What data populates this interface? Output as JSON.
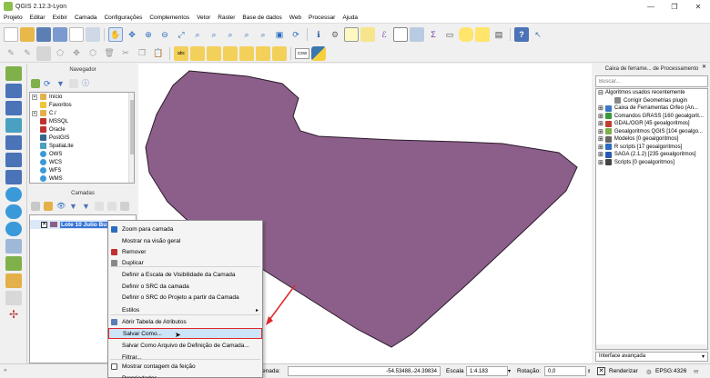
{
  "window": {
    "title": "QGIS 2.12.3-Lyon"
  },
  "menu": [
    "Projeto",
    "Editar",
    "Exibir",
    "Camada",
    "Configurações",
    "Complementos",
    "Vetor",
    "Raster",
    "Base de dados",
    "Web",
    "Processar",
    "Ajuda"
  ],
  "toolbar": {
    "csw_label": "CSW"
  },
  "navigator": {
    "title": "Navegador",
    "items": [
      {
        "label": "Início",
        "icon": "folder-icon",
        "expandable": true
      },
      {
        "label": "Favoritos",
        "icon": "star-icon",
        "expandable": false
      },
      {
        "label": "C:/",
        "icon": "folder-icon",
        "expandable": true
      },
      {
        "label": "MSSQL",
        "icon": "database-icon",
        "expandable": false
      },
      {
        "label": "Oracle",
        "icon": "database-icon",
        "expandable": false
      },
      {
        "label": "PostGIS",
        "icon": "postgis-icon",
        "expandable": false
      },
      {
        "label": "SpatiaLite",
        "icon": "spatialite-icon",
        "expandable": false
      },
      {
        "label": "OWS",
        "icon": "globe-icon",
        "expandable": false
      },
      {
        "label": "WCS",
        "icon": "globe-icon",
        "expandable": false
      },
      {
        "label": "WFS",
        "icon": "globe-icon",
        "expandable": false
      },
      {
        "label": "WMS",
        "icon": "globe-icon",
        "expandable": false
      }
    ]
  },
  "layers_panel": {
    "title": "Camadas",
    "layer": {
      "name": "Lote 10 Julio Bu",
      "checked": true,
      "check_mark": "✕"
    }
  },
  "context_menu": {
    "items": [
      {
        "label": "Zoom para camada",
        "icon": "zoom-layer-icon"
      },
      {
        "label": "Mostrar na visão geral",
        "icon": ""
      },
      {
        "label": "Remover",
        "icon": "remove-icon"
      },
      {
        "label": "Duplicar",
        "icon": "duplicate-icon"
      },
      {
        "label": "Definir a Escala de Visibilidade da Camada",
        "icon": ""
      },
      {
        "label": "Definir o SRC da camada",
        "icon": ""
      },
      {
        "label": "Definir o SRC do Projeto a partir da Camada",
        "icon": ""
      },
      {
        "label": "Estilos",
        "icon": "",
        "submenu": true
      },
      {
        "label": "Abrir Tabela de Atributos",
        "icon": "table-icon"
      },
      {
        "label": "Salvar Como...",
        "icon": "",
        "highlighted": true
      },
      {
        "label": "Salvar Como Arquivo de Definição de Camada...",
        "icon": ""
      },
      {
        "label": "Filtrar...",
        "icon": ""
      },
      {
        "label": "Mostrar contagem da feição",
        "icon": "",
        "checkbox": true
      },
      {
        "label": "Propriedades",
        "icon": ""
      }
    ],
    "submenu_arrow": "▸"
  },
  "processing_toolbox": {
    "title": "Caixa de ferrame... de Processamento",
    "search_placeholder": "Buscar...",
    "items": [
      {
        "label": "Algoritmos usados recentemente",
        "expand": "⊟",
        "indent": 0,
        "icon": ""
      },
      {
        "label": "Corrigir Geometrias plugin",
        "expand": "",
        "indent": 2,
        "icon": "gear-icon"
      },
      {
        "label": "Caixa de Ferramentas Orfeo (An...",
        "expand": "⊞",
        "indent": 0,
        "icon": "orfeo-icon"
      },
      {
        "label": "Comandos GRASS [160 geoalgorit...",
        "expand": "⊞",
        "indent": 0,
        "icon": "grass-icon"
      },
      {
        "label": "GDAL/OGR [45 geoalgoritmos]",
        "expand": "⊞",
        "indent": 0,
        "icon": "gdal-icon"
      },
      {
        "label": "Geoalgoritmos QGIS [104 geoalgo...",
        "expand": "⊞",
        "indent": 0,
        "icon": "qgis-icon"
      },
      {
        "label": "Modelos [0 geoalgoritmos]",
        "expand": "⊞",
        "indent": 0,
        "icon": "model-icon"
      },
      {
        "label": "R scripts [17 geoalgoritmos]",
        "expand": "⊞",
        "indent": 0,
        "icon": "r-icon"
      },
      {
        "label": "SAGA (2.1.2) [235 geoalgoritmos]",
        "expand": "⊞",
        "indent": 0,
        "icon": "saga-icon"
      },
      {
        "label": "Scripts [0 geoalgoritmos]",
        "expand": "⊞",
        "indent": 0,
        "icon": "script-icon"
      }
    ],
    "mode_label": "Interface avançada",
    "mode_arrow": "▾"
  },
  "statusbar": {
    "coord_label": "enada:",
    "coord_value": "-54.53488,-24.39834",
    "scale_label": "Escala",
    "scale_value": "1:4.183",
    "rotation_label": "Rotação:",
    "rotation_value": "0,0",
    "render_label": "Renderizar",
    "crs_label": "EPSG:4326"
  },
  "colors": {
    "polygon_fill": "#8c5f8a",
    "polygon_stroke": "#2a1a2a",
    "highlight_border": "#e0262a",
    "selection_blue": "#3875d7"
  }
}
